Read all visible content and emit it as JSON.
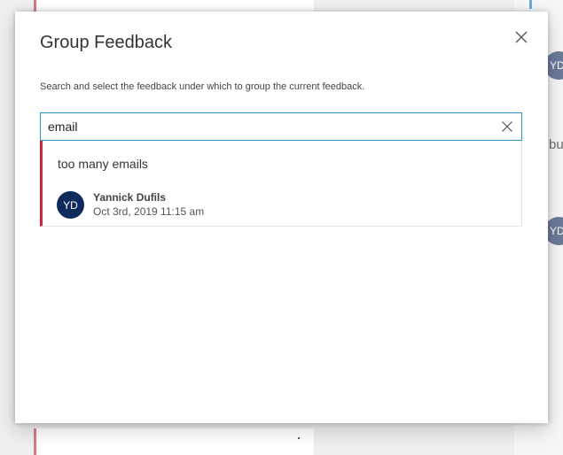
{
  "background": {
    "avatar_initials": "YD",
    "partial_text": "bu"
  },
  "dialog": {
    "title": "Group Feedback",
    "instructions": "Search and select the feedback under which to group the current feedback.",
    "close_icon": "close-icon"
  },
  "search": {
    "value": "email",
    "placeholder": "",
    "clear_icon": "clear-icon"
  },
  "results": [
    {
      "title": "too many emails",
      "author_initials": "YD",
      "author": "Yannick Dufils",
      "timestamp": "Oct 3rd, 2019 11:15 am"
    }
  ],
  "colors": {
    "accent_border": "#c8283f",
    "input_focus": "#2a8dc9",
    "avatar_bg": "#0f2a5c"
  }
}
